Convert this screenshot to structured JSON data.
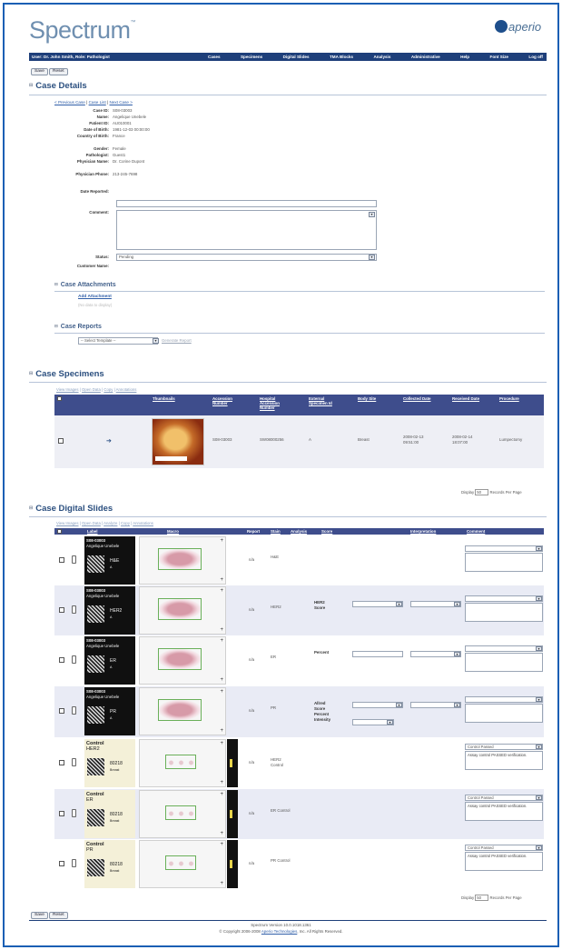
{
  "header": {
    "logo": "Spectrum",
    "tm": "™",
    "aperio": "aperio"
  },
  "nav": {
    "user": "User: Dr. John Smith, Role: Pathologist",
    "items": [
      "Cases",
      "Specimens",
      "Digital Slides",
      "TMA Blocks",
      "Analysis",
      "Administrative",
      "Help",
      "Font Size",
      "Log off"
    ]
  },
  "buttons": {
    "save": "Save",
    "reset": "Reset"
  },
  "case_details": {
    "title": "Case Details",
    "nav_links": [
      "< Previous Case",
      "Case List",
      "Next Case >"
    ],
    "fields": [
      {
        "label": "Case ID:",
        "value": "S08-03003"
      },
      {
        "label": "Name:",
        "value": "Angelique Unebele"
      },
      {
        "label": "Patient ID:",
        "value": "AU010001"
      },
      {
        "label": "Date of Birth:",
        "value": "1981-12-03 00:00:00"
      },
      {
        "label": "Country of Birth:",
        "value": "France"
      },
      {
        "label": "Gender:",
        "value": "Female"
      },
      {
        "label": "Pathologist:",
        "value": "Guest1"
      },
      {
        "label": "Physician Name:",
        "value": "Dr. Corine Dupont"
      },
      {
        "label": "Physician Phone:",
        "value": "213-245-7698"
      }
    ],
    "date_reported_label": "Date Reported:",
    "comment_label": "Comment:",
    "status_label": "Status:",
    "status_value": "Pending",
    "customer_label": "Customer Name:"
  },
  "attachments": {
    "title": "Case Attachments",
    "add": "Add Attachment",
    "empty": "(No data to display)"
  },
  "reports": {
    "title": "Case Reports",
    "select": "-- Select Template --",
    "generate": "Generate Report"
  },
  "specimens": {
    "title": "Case Specimens",
    "actions": [
      "View Images",
      "Open Data",
      "Copy",
      "Annotations"
    ],
    "columns": [
      "Thumbnails",
      "Accession Number",
      "Hospital Accession Number",
      "External Specimen Id",
      "Body Site",
      "Collected Date",
      "Received Date",
      "Procedure"
    ],
    "row": {
      "accession": "S08-03003",
      "hospital": "SW08000256",
      "external": "A",
      "body_site": "Breast",
      "collected": "2008-02-13 09:51:00",
      "received": "2008-02-14 18:07:00",
      "procedure": "Lumpectomy"
    },
    "display_label": "Display",
    "display_value": "50",
    "per_page": "Records Per Page"
  },
  "slides": {
    "title": "Case Digital Slides",
    "actions": [
      "View Images",
      "Open Data",
      "Analyze",
      "Copy",
      "Annotations"
    ],
    "columns": [
      "Label",
      "Macro",
      "Report",
      "Stain",
      "Analysis",
      "Score",
      "Interpretation",
      "Comment"
    ],
    "rows": [
      {
        "label_top": "S08-03003",
        "label_sub": "Angelique Unebele",
        "label_code": "H&E",
        "label_side": "A",
        "stain": "H&E",
        "report": "n/a",
        "score_lines": [],
        "comment": "",
        "control": false
      },
      {
        "label_top": "S08-03003",
        "label_sub": "Angelique Unebele",
        "label_code": "HER2",
        "label_side": "A",
        "stain": "HER2",
        "report": "n/a",
        "score_lines": [
          "HER2",
          "Score"
        ],
        "comment": "",
        "control": false
      },
      {
        "label_top": "S08-03003",
        "label_sub": "Angelique Unebele",
        "label_code": "ER",
        "label_side": "A",
        "stain": "ER",
        "report": "n/a",
        "score_lines": [
          "Percent"
        ],
        "comment": "",
        "control": false
      },
      {
        "label_top": "S08-03003",
        "label_sub": "Angelique Unebele",
        "label_code": "PR",
        "label_side": "A",
        "stain": "PR",
        "report": "n/a",
        "score_lines": [
          "Allred",
          "Score",
          "Percent",
          "Intensity"
        ],
        "comment": "",
        "control": false
      },
      {
        "label_top": "Control",
        "label_sub": "HER2",
        "label_code": "80218",
        "label_side": "Breast",
        "stain": "HER2 Control",
        "report": "n/a",
        "score_lines": [],
        "comment": "Assay control PASSED verification.",
        "dropdown": "Control Passed",
        "control": true
      },
      {
        "label_top": "Control",
        "label_sub": "ER",
        "label_code": "80218",
        "label_side": "Breast",
        "stain": "ER Control",
        "report": "n/a",
        "score_lines": [],
        "comment": "Assay control PASSED verification.",
        "dropdown": "Control Passed",
        "control": true
      },
      {
        "label_top": "Control",
        "label_sub": "PR",
        "label_code": "80218",
        "label_side": "Breast",
        "stain": "PR Control",
        "report": "n/a",
        "score_lines": [],
        "comment": "Assay control PASSED verification.",
        "dropdown": "Control Passed",
        "control": true
      }
    ],
    "display_label": "Display",
    "display_value": "50",
    "per_page": "Records Per Page"
  },
  "footer": {
    "version": "Spectrum Version 10.0.1018.1361",
    "copyright_pre": "© Copyright 2006-2008 ",
    "company": "Aperio Technologies",
    "copyright_post": ", Inc. All Rights Reserved."
  }
}
